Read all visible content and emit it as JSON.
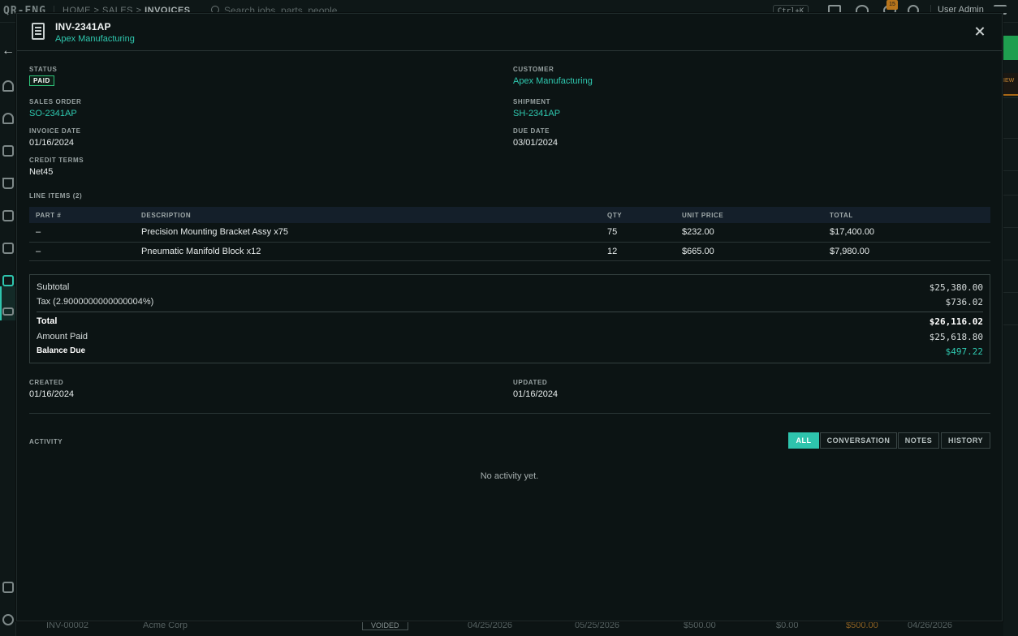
{
  "background": {
    "logo": "QR-ENG",
    "breadcrumb": [
      "HOME",
      "SALES",
      "INVOICES"
    ],
    "search_placeholder": "Search jobs, parts, people",
    "shortcut": "Ctrl+K",
    "notification_count": "15",
    "user": "User Admin",
    "side_tab_fragment": "IEW",
    "bottom_row": {
      "id": "INV-00002",
      "customer": "Acme Corp",
      "status": "VOIDED",
      "date1": "04/25/2026",
      "date2": "05/25/2026",
      "amount": "$500.00",
      "paid": "$0.00",
      "balance": "$500.00",
      "date3": "04/26/2026"
    }
  },
  "modal": {
    "title": "INV-2341AP",
    "subtitle": "Apex Manufacturing",
    "fields": {
      "status_label": "STATUS",
      "status": "PAID",
      "customer_label": "CUSTOMER",
      "customer": "Apex Manufacturing",
      "sales_order_label": "SALES ORDER",
      "sales_order": "SO-2341AP",
      "shipment_label": "SHIPMENT",
      "shipment": "SH-2341AP",
      "invoice_date_label": "INVOICE DATE",
      "invoice_date": "01/16/2024",
      "due_date_label": "DUE DATE",
      "due_date": "03/01/2024",
      "credit_terms_label": "CREDIT TERMS",
      "credit_terms": "Net45"
    },
    "line_items": {
      "heading": "LINE ITEMS (2)",
      "columns": [
        "PART #",
        "DESCRIPTION",
        "QTY",
        "UNIT PRICE",
        "TOTAL"
      ],
      "rows": [
        [
          "–",
          "Precision Mounting Bracket Assy x75",
          "75",
          "$232.00",
          "$17,400.00"
        ],
        [
          "–",
          "Pneumatic Manifold Block x12",
          "12",
          "$665.00",
          "$7,980.00"
        ]
      ]
    },
    "totals": {
      "subtotal_label": "Subtotal",
      "subtotal": "$25,380.00",
      "tax_label": "Tax (2.9000000000000004%)",
      "tax": "$736.02",
      "total_label": "Total",
      "total": "$26,116.02",
      "paid_label": "Amount Paid",
      "paid": "$25,618.80",
      "balance_label": "Balance Due",
      "balance": "$497.22"
    },
    "meta": {
      "created_label": "CREATED",
      "created": "01/16/2024",
      "updated_label": "UPDATED",
      "updated": "01/16/2024"
    },
    "activity": {
      "heading": "ACTIVITY",
      "tabs": [
        "ALL",
        "CONVERSATION",
        "NOTES",
        "HISTORY"
      ],
      "active_tab": "ALL",
      "empty": "No activity yet."
    }
  },
  "colors": {
    "accent": "#2ec4ad",
    "paid_badge_border": "#2ec47a",
    "background": "#0c1414"
  }
}
